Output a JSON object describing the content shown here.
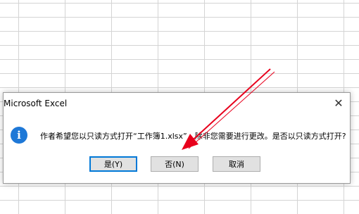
{
  "dialog": {
    "title": "Microsoft Excel",
    "close_glyph": "✕",
    "icon_glyph": "i",
    "message": "作者希望您以只读方式打开“工作簿1.xlsx”，除非您需要进行更改。是否以只读方式打开?",
    "buttons": {
      "yes": "是(Y)",
      "no": "否(N)",
      "cancel": "取消"
    }
  },
  "colors": {
    "accent": "#0078d7",
    "info_icon": "#1e78d7",
    "annotation_arrow": "#e8001c"
  }
}
